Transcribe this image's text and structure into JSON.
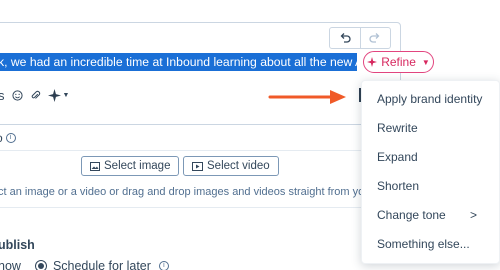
{
  "editor": {
    "selected_text": "k, we had an incredible time at Inbound learning about all the new AI features!",
    "undo_icon": "undo-icon",
    "redo_icon": "redo-icon"
  },
  "refine_button": {
    "label": "Refine",
    "icon": "sparkle-icon"
  },
  "toolbar": {
    "partial_label": "s",
    "icons": [
      "emoji-icon",
      "attachment-icon",
      "ai-sparkle-icon"
    ]
  },
  "media": {
    "section_label": "o",
    "select_image_label": "Select image",
    "select_video_label": "Select video",
    "help_text": "ct an image or a video or drag and drop images and videos straight from your desktop"
  },
  "publish": {
    "title": "ublish",
    "now_label": "now",
    "schedule_label": "Schedule for later"
  },
  "refine_menu": {
    "items": [
      {
        "label": "Apply brand identity"
      },
      {
        "label": "Rewrite"
      },
      {
        "label": "Expand"
      },
      {
        "label": "Shorten"
      },
      {
        "label": "Change tone",
        "has_submenu": true
      },
      {
        "label": "Something else..."
      }
    ]
  },
  "colors": {
    "highlight": "#1a6fd6",
    "refine_accent": "#d7285f",
    "arrow": "#f05a28",
    "text": "#33475b"
  }
}
